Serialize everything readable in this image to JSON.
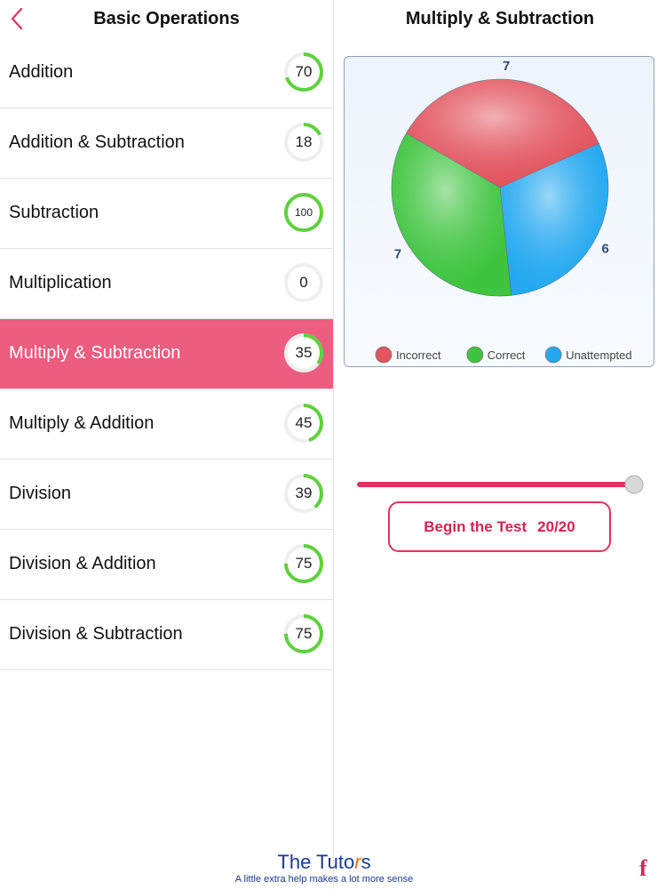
{
  "left_panel": {
    "title": "Basic Operations",
    "items": [
      {
        "label": "Addition",
        "score": 70
      },
      {
        "label": "Addition & Subtraction",
        "score": 18
      },
      {
        "label": "Subtraction",
        "score": 100
      },
      {
        "label": "Multiplication",
        "score": 0
      },
      {
        "label": "Multiply & Subtraction",
        "score": 35,
        "selected": true
      },
      {
        "label": "Multiply & Addition",
        "score": 45
      },
      {
        "label": "Division",
        "score": 39
      },
      {
        "label": "Division & Addition",
        "score": 75
      },
      {
        "label": "Division & Subtraction",
        "score": 75
      }
    ]
  },
  "right_panel": {
    "title": "Multiply & Subtraction",
    "slider_value": 1.0,
    "begin_button": {
      "label": "Begin the Test",
      "count": "20/20"
    }
  },
  "chart_data": {
    "type": "pie",
    "slices": [
      {
        "name": "Incorrect",
        "value": 7,
        "color": "#e2545e"
      },
      {
        "name": "Correct",
        "value": 7,
        "color": "#3ec43e"
      },
      {
        "name": "Unattempted",
        "value": 6,
        "color": "#23a8f0"
      }
    ],
    "legend_position": "bottom"
  },
  "footer": {
    "brand_prefix": "The Tuto",
    "brand_r": "r",
    "brand_suffix": "s",
    "tagline": "A little extra help makes a lot more sense",
    "facebook": "f"
  },
  "colors": {
    "accent": "#e0325f",
    "selected_row": "#ec5d80",
    "ring_progress": "#5fd13e",
    "ring_track": "#eeeeee"
  },
  "icons": {
    "back": "chevron-left-icon",
    "facebook": "facebook-icon"
  }
}
